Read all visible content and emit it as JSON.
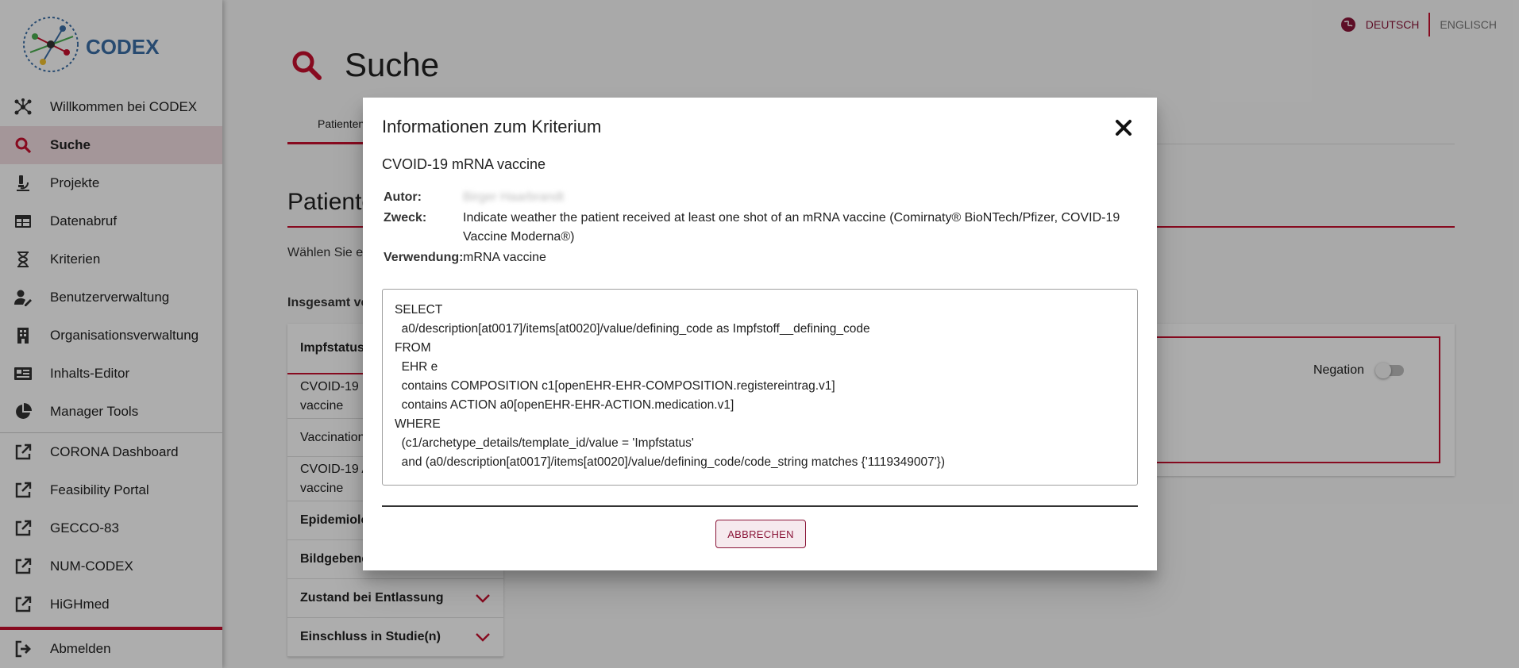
{
  "header": {
    "lang_de": "DEUTSCH",
    "lang_en": "ENGLISCH"
  },
  "sidebar": {
    "logo_text": "CODEX",
    "items": [
      {
        "label": "Willkommen bei CODEX",
        "icon": "network-icon"
      },
      {
        "label": "Suche",
        "icon": "search-icon"
      },
      {
        "label": "Projekte",
        "icon": "microscope-icon"
      },
      {
        "label": "Datenabruf",
        "icon": "table-icon"
      },
      {
        "label": "Kriterien",
        "icon": "hourglass-icon"
      },
      {
        "label": "Benutzerverwaltung",
        "icon": "user-edit-icon"
      },
      {
        "label": "Organisationsverwaltung",
        "icon": "building-icon"
      },
      {
        "label": "Inhalts-Editor",
        "icon": "newspaper-icon"
      },
      {
        "label": "Manager Tools",
        "icon": "pie-chart-icon"
      }
    ],
    "external": [
      {
        "label": "CORONA Dashboard"
      },
      {
        "label": "Feasibility Portal"
      },
      {
        "label": "GECCO-83"
      },
      {
        "label": "NUM-CODEX"
      },
      {
        "label": "HiGHmed"
      }
    ],
    "logout": "Abmelden"
  },
  "page": {
    "title": "Suche",
    "tab": "Patienten",
    "section_title": "Patiente",
    "intro": "Wählen Sie ei",
    "total": "Insgesamt ve",
    "categories": {
      "head": "Impfstatus",
      "items": [
        "CVOID-19 n\nvaccine",
        "Vaccination",
        "CVOID-19 A\nvaccine"
      ],
      "groups": [
        "Epidemiolo",
        "Bildgebend",
        "Zustand bei Entlassung",
        "Einschluss in Studie(n)"
      ]
    },
    "negation": "Negation"
  },
  "modal": {
    "title": "Informationen zum Kriterium",
    "criterion": "CVOID-19 mRNA vaccine",
    "author_label": "Autor:",
    "author_value": "Birger Haarbrandt",
    "purpose_label": "Zweck:",
    "purpose_value": "Indicate weather the patient received at least one shot of an mRNA vaccine (Comirnaty® BioNTech/Pfizer, COVID-19 Vaccine Moderna®)",
    "usage_label": "Verwendung:",
    "usage_value": "mRNA vaccine",
    "query": "SELECT\n  a0/description[at0017]/items[at0020]/value/defining_code as Impfstoff__defining_code\nFROM\n  EHR e\n  contains COMPOSITION c1[openEHR-EHR-COMPOSITION.registereintrag.v1]\n  contains ACTION a0[openEHR-EHR-ACTION.medication.v1]\nWHERE\n  (c1/archetype_details/template_id/value = 'Impfstatus'\n  and (a0/description[at0017]/items[at0020]/value/defining_code/code_string matches {'1119349007'})",
    "cancel_label": "ABBRECHEN"
  },
  "colors": {
    "accent": "#c8102e",
    "accent_dark": "#8a1538"
  }
}
